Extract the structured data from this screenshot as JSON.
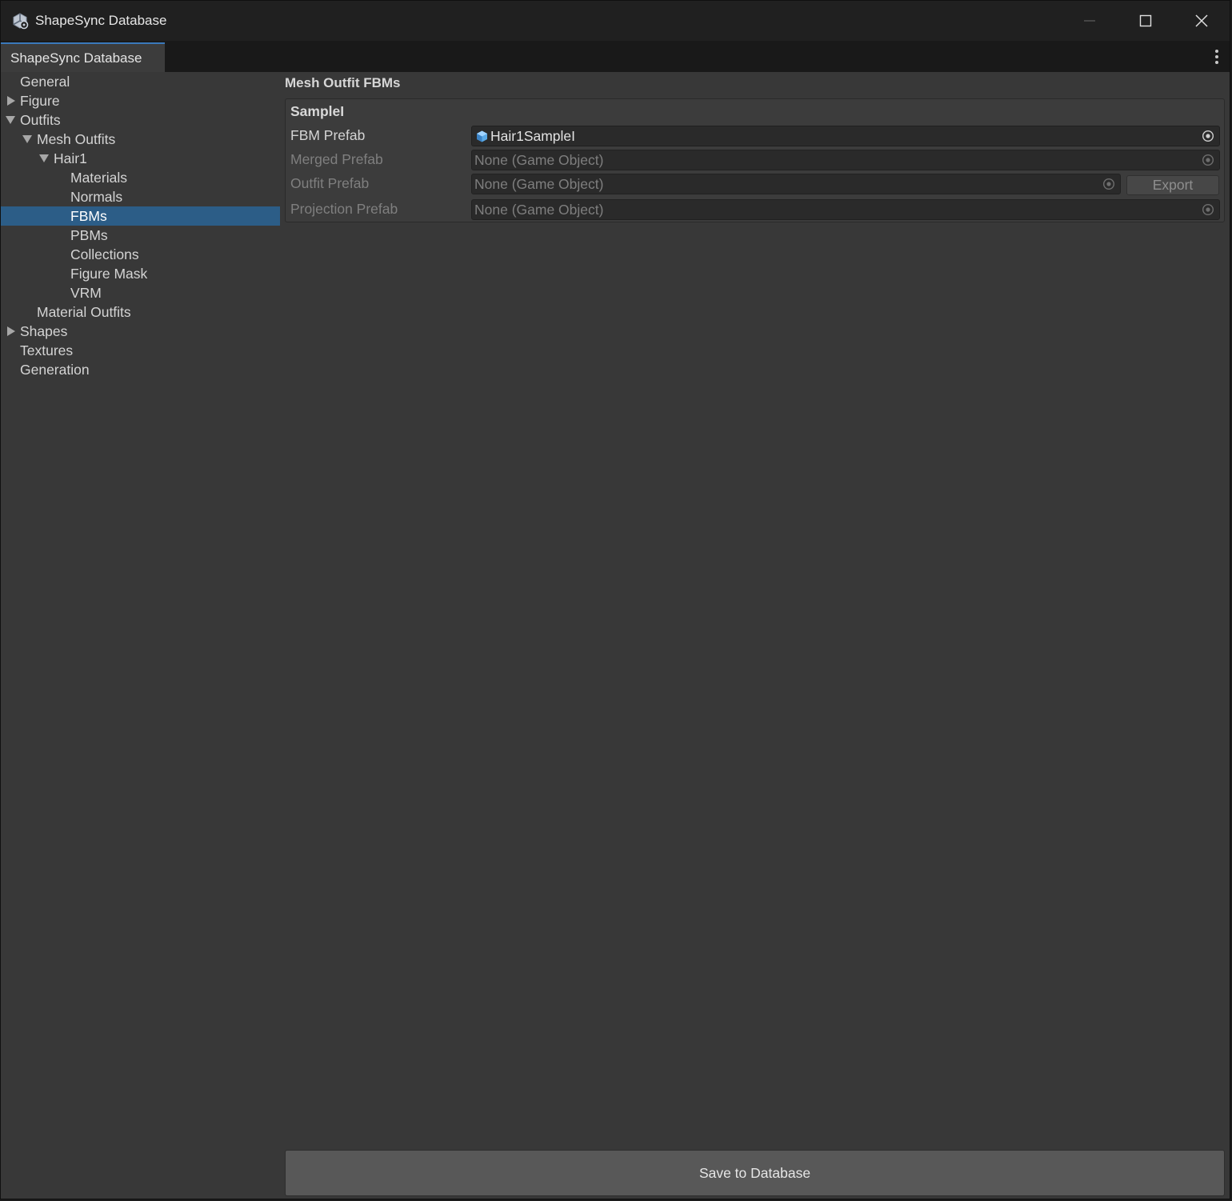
{
  "window": {
    "title": "ShapeSync Database",
    "controls": {
      "minimize": "minimize-icon",
      "maximize": "maximize-icon",
      "close": "close-icon"
    }
  },
  "tab": {
    "label": "ShapeSync Database"
  },
  "tree": [
    {
      "label": "General",
      "depth": 0,
      "caret": "none",
      "selected": false
    },
    {
      "label": "Figure",
      "depth": 0,
      "caret": "collapsed",
      "selected": false
    },
    {
      "label": "Outfits",
      "depth": 0,
      "caret": "expanded",
      "selected": false
    },
    {
      "label": "Mesh Outfits",
      "depth": 1,
      "caret": "expanded",
      "selected": false
    },
    {
      "label": "Hair1",
      "depth": 2,
      "caret": "expanded",
      "selected": false
    },
    {
      "label": "Materials",
      "depth": 3,
      "caret": "none",
      "selected": false
    },
    {
      "label": "Normals",
      "depth": 3,
      "caret": "none",
      "selected": false
    },
    {
      "label": "FBMs",
      "depth": 3,
      "caret": "none",
      "selected": true
    },
    {
      "label": "PBMs",
      "depth": 3,
      "caret": "none",
      "selected": false
    },
    {
      "label": "Collections",
      "depth": 3,
      "caret": "none",
      "selected": false
    },
    {
      "label": "Figure Mask",
      "depth": 3,
      "caret": "none",
      "selected": false
    },
    {
      "label": "VRM",
      "depth": 3,
      "caret": "none",
      "selected": false
    },
    {
      "label": "Material Outfits",
      "depth": 1,
      "caret": "none",
      "selected": false
    },
    {
      "label": "Shapes",
      "depth": 0,
      "caret": "collapsed",
      "selected": false
    },
    {
      "label": "Textures",
      "depth": 0,
      "caret": "none",
      "selected": false
    },
    {
      "label": "Generation",
      "depth": 0,
      "caret": "none",
      "selected": false
    }
  ],
  "main": {
    "section_title": "Mesh Outfit FBMs",
    "panel": {
      "title": "SampleI",
      "rows": [
        {
          "label": "FBM Prefab",
          "value": "Hair1SampleI",
          "enabled": true,
          "icon": "prefab-icon"
        },
        {
          "label": "Merged Prefab",
          "value": "None (Game Object)",
          "enabled": false
        },
        {
          "label": "Outfit Prefab",
          "value": "None (Game Object)",
          "enabled": false
        },
        {
          "label": "Projection Prefab",
          "value": "None (Game Object)",
          "enabled": false
        }
      ],
      "export_label": "Export"
    },
    "save_label": "Save to Database"
  },
  "colors": {
    "background": "#383838",
    "titlebar": "#202020",
    "selection": "#2c5d87",
    "tab_accent": "#3a79bb",
    "button": "#585858"
  }
}
